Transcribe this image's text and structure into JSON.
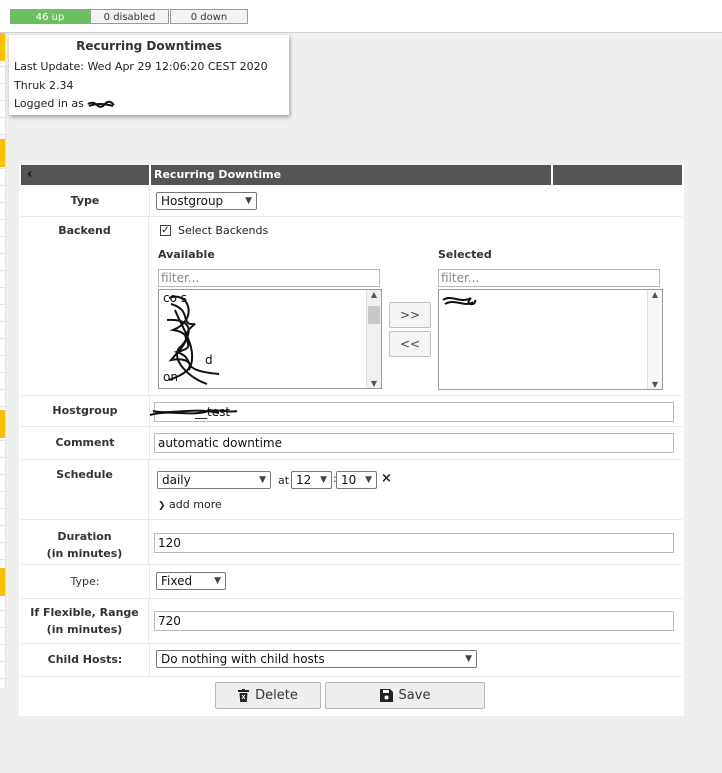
{
  "status": {
    "up": "46 up",
    "disabled": "0 disabled",
    "down": "0 down"
  },
  "info": {
    "title": "Recurring Downtimes",
    "last_update": "Last Update: Wed Apr 29 12:06:20 CEST 2020",
    "version": "Thruk 2.34",
    "logged_in": "Logged in as"
  },
  "form": {
    "back": "‹",
    "title": "Recurring Downtime",
    "type_label": "Type",
    "type_value": "Hostgroup",
    "backend_label": "Backend",
    "select_backends": "Select Backends",
    "available": "Available",
    "selected": "Selected",
    "filter_placeholder": "filter...",
    "move_right": ">>",
    "move_left": "<<",
    "available_items": [
      "co_s",
      "_ _",
      "_ _",
      "_ _",
      "_ _",
      "_ _d",
      "_ _on"
    ],
    "hostgroup_label": "Hostgroup",
    "hostgroup_value": "__test",
    "comment_label": "Comment",
    "comment_value": "automatic downtime",
    "schedule_label": "Schedule",
    "schedule_freq": "daily",
    "at": "at",
    "hour": "12",
    "minute": "10",
    "remove": "×",
    "add_more": "add more",
    "duration_label": "Duration",
    "duration_sub": "(in minutes)",
    "duration_value": "120",
    "type2_label": "Type:",
    "type2_value": "Fixed",
    "flex_label": "If Flexible, Range",
    "flex_sub": "(in minutes)",
    "flex_value": "720",
    "child_label": "Child Hosts:",
    "child_value": "Do nothing with child hosts",
    "delete": "Delete",
    "save": "Save"
  }
}
